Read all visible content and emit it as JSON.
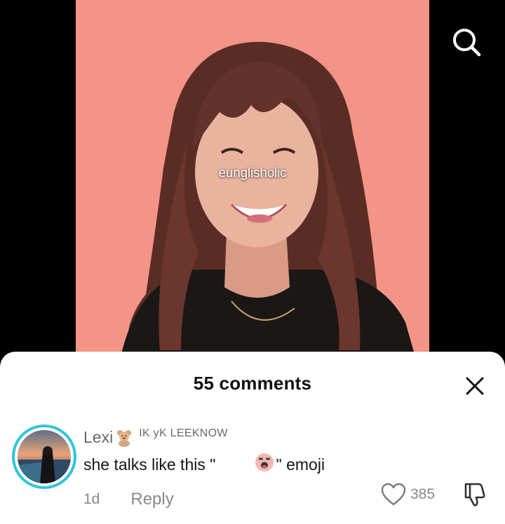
{
  "video": {
    "watermark": "eunglisholic",
    "background_color": "#f49486"
  },
  "top_bar": {
    "search_icon": "search-icon"
  },
  "comments_sheet": {
    "title": "55 comments",
    "close_icon": "close-icon",
    "comments": [
      {
        "author": "Lexi",
        "author_badge_icon": "teddy-bear-icon",
        "author_tag": "IK yK LEEKNOW",
        "text_before_emoji": "she talks like this \"",
        "emoji_icon": "shocked-face-emoji-icon",
        "text_after_emoji": "\" emoji",
        "time": "1d",
        "reply_label": "Reply",
        "like_count": "385",
        "avatar_ring_color": "#2fc6d8"
      }
    ]
  }
}
